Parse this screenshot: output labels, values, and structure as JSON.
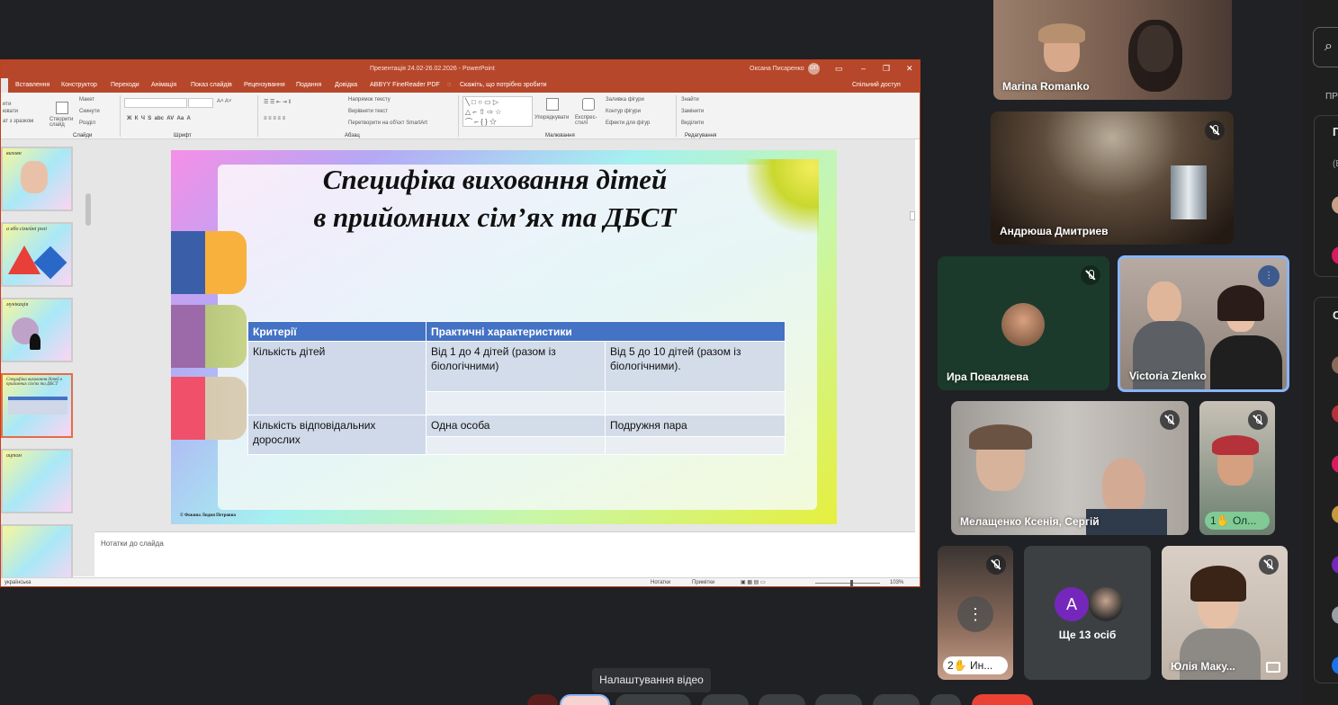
{
  "powerpoint": {
    "window_title": "Презентація 24.02-26.02.2026 - PowerPoint",
    "user_name": "Оксана Писаренко",
    "user_initials": "ОП",
    "tabs": [
      "Вставлення",
      "Конструктор",
      "Переходи",
      "Анімація",
      "Показ слайдів",
      "Рецензування",
      "Подання",
      "Довідка",
      "ABBYY FineReader PDF"
    ],
    "tell_me": "Скажіть, що потрібно зробити",
    "share": "Спільний доступ",
    "ribbon": {
      "groups": [
        "Слайди",
        "Шрифт",
        "Абзац",
        "Малювання",
        "Редагування"
      ],
      "layout": "Макет",
      "reset": "Скинути",
      "section": "Розділ",
      "new_slide": "Створити слайд",
      "paste_hint": "ат з зразком",
      "text_direction": "Напрямок тексту",
      "align_text": "Вирівняти текст",
      "smartart": "Перетворити на об'єкт SmartArt",
      "arrange": "Упорядкувати",
      "quick_styles": "Експрес-стилі",
      "shape_fill": "Заливка фігури",
      "shape_outline": "Контур фігури",
      "shape_effects": "Ефекти для фігур",
      "find": "Знайти",
      "replace": "Замінити",
      "select": "Виділити"
    },
    "thumbnails": [
      {
        "label": "виховн"
      },
      {
        "label": "а або сімейні ролі"
      },
      {
        "label": "мунікація"
      },
      {
        "label": "Специфіка виховання дітей в прийомних сім'ях та ДБСТ"
      },
      {
        "label": "ацтом"
      },
      {
        "label": ""
      }
    ],
    "notes_placeholder": "Нотатки до слайда",
    "status": {
      "language": "українська",
      "notes": "Нотатки",
      "comments": "Примітки",
      "zoom": "103%"
    }
  },
  "slide": {
    "title_line1": "Специфіка виховання дітей",
    "title_line2": "в прийомних сім’ях та ДБСТ",
    "credit": "© Фокина Лидия Петровна",
    "table": {
      "headers": [
        "Критерії",
        "Практичні характеристики"
      ],
      "rows": [
        [
          "Кількість дітей",
          "Від 1 до 4 дітей (разом із біологічними)",
          "Від 5 до 10 дітей (разом із біологічними)."
        ],
        [
          "Кількість відповідальних дорослих",
          "Одна особа",
          "Подружня пара"
        ]
      ]
    }
  },
  "participants": [
    {
      "name": "Marina Romanko"
    },
    {
      "name": "Андрюша Дмитриев"
    },
    {
      "name": "Ира Поваляева"
    },
    {
      "name": "Victoria Zlenko"
    },
    {
      "name": "Мелащенко Ксенія, Сергій"
    },
    {
      "name": "Ол...",
      "hand_count": "1"
    },
    {
      "name": "Ин...",
      "hand_count": "2"
    },
    {
      "name": "Ще 13 осіб",
      "avatar_letter": "A"
    },
    {
      "name": "Юлія Маку..."
    }
  ],
  "side_panel": {
    "label1": "ПР",
    "label2": "П",
    "label3": "(Е",
    "label4": "С"
  },
  "tooltip": "Налаштування відео",
  "colors": {
    "ppt_accent": "#b7472a",
    "table_header": "#4472c4",
    "meet_bg": "#202124",
    "active_speaker": "#8ab4f8",
    "hand_badge": "#81c995",
    "end_call": "#ea4335"
  }
}
